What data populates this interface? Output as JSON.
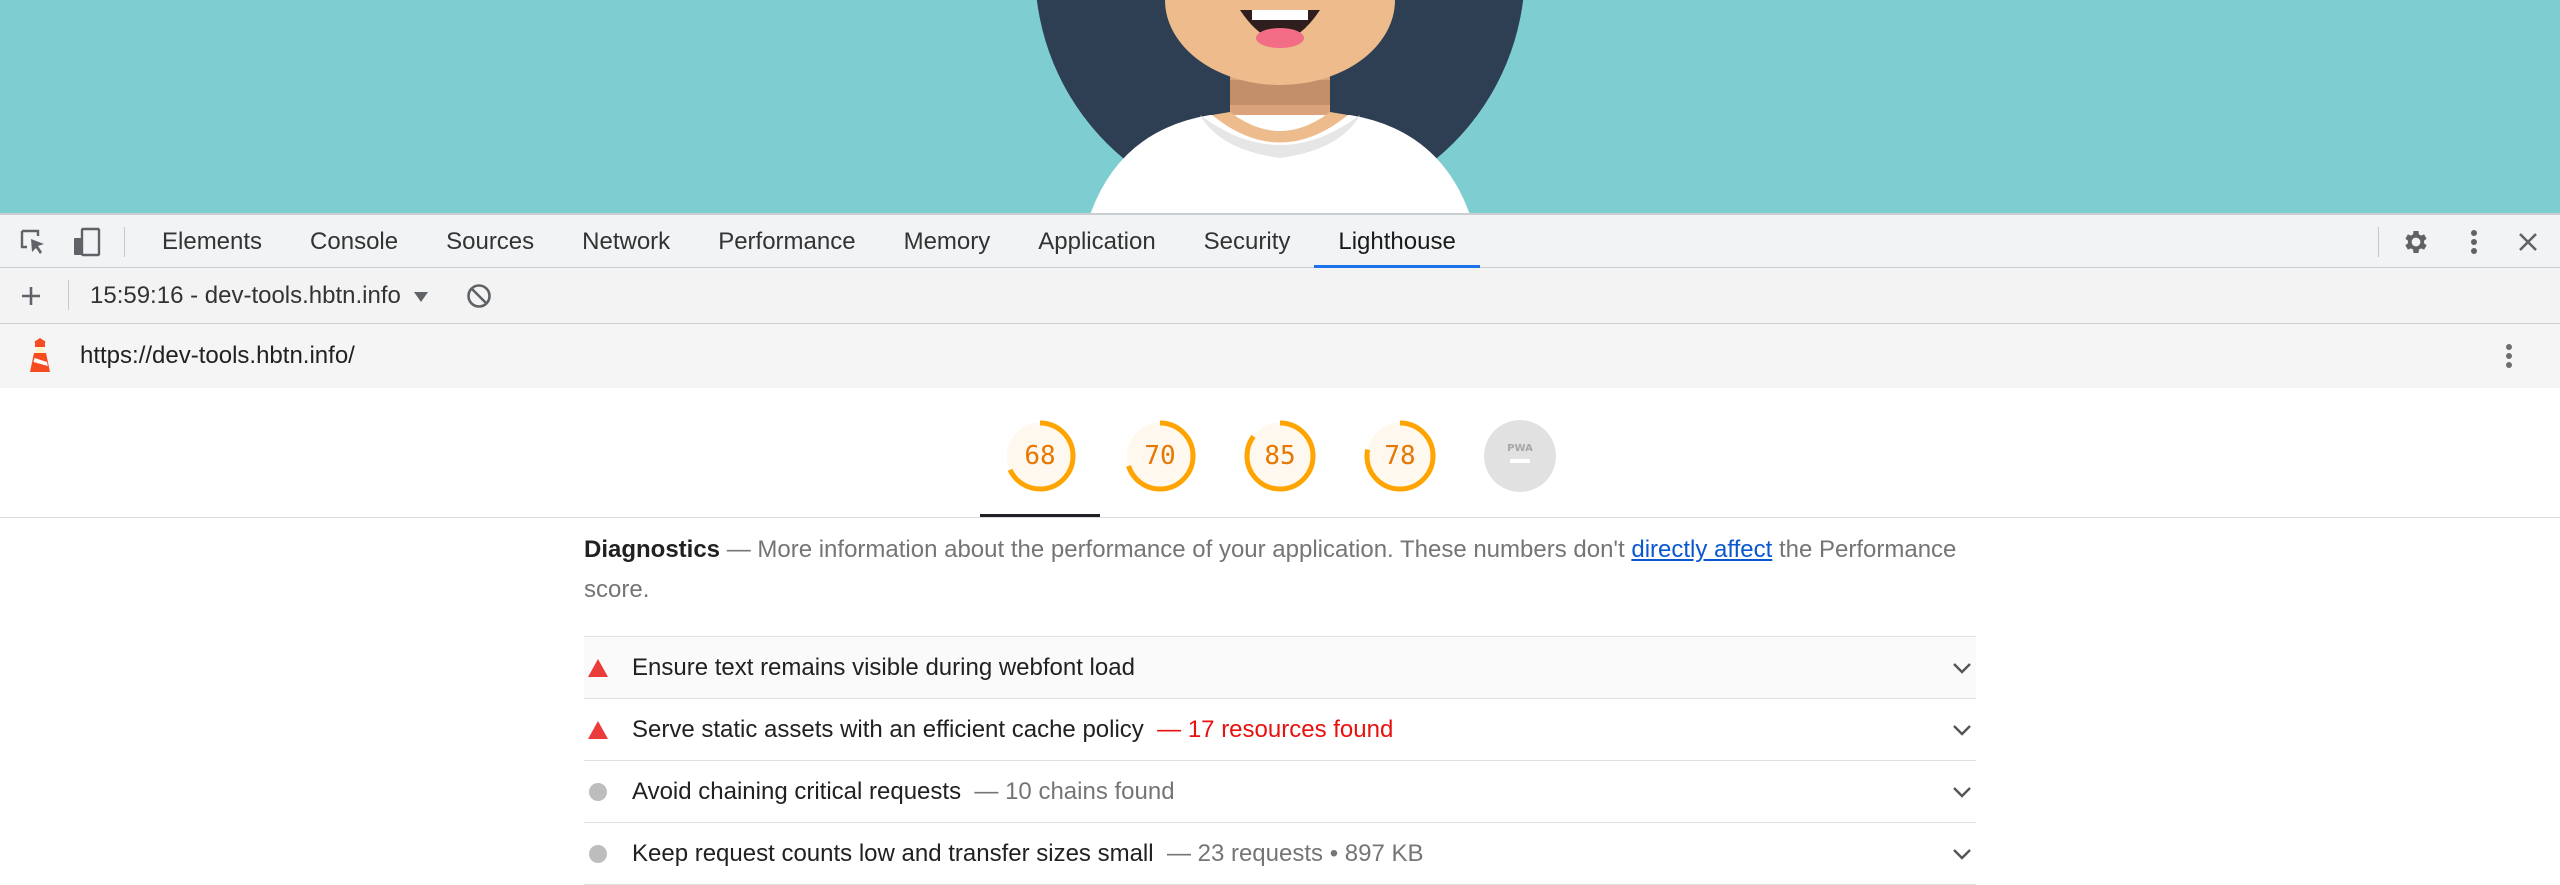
{
  "devtools": {
    "tabs": [
      {
        "label": "Elements"
      },
      {
        "label": "Console"
      },
      {
        "label": "Sources"
      },
      {
        "label": "Network"
      },
      {
        "label": "Performance"
      },
      {
        "label": "Memory"
      },
      {
        "label": "Application"
      },
      {
        "label": "Security"
      },
      {
        "label": "Lighthouse",
        "active": true
      }
    ]
  },
  "report": {
    "selector_label": "15:59:16 - dev-tools.hbtn.info",
    "url": "https://dev-tools.hbtn.info/"
  },
  "gauges": [
    {
      "value": "68",
      "score": 0.68
    },
    {
      "value": "70",
      "score": 0.7
    },
    {
      "value": "85",
      "score": 0.85
    },
    {
      "value": "78",
      "score": 0.78
    },
    {
      "value": "PWA",
      "score": null
    }
  ],
  "diagnostics": {
    "title": "Diagnostics",
    "separator": "—",
    "text_before_link": "More information about the performance of your application. These numbers don't",
    "link_text": "directly affect",
    "text_after_link": "the Performance score."
  },
  "audits": [
    {
      "title": "Ensure text remains visible during webfont load",
      "detail": "",
      "status": "fail"
    },
    {
      "title": "Serve static assets with an efficient cache policy",
      "detail": "— 17 resources found",
      "status": "fail"
    },
    {
      "title": "Avoid chaining critical requests",
      "detail": "— 10 chains found",
      "status": "info"
    },
    {
      "title": "Keep request counts low and transfer sizes small",
      "detail": "— 23 requests • 897 KB",
      "status": "info"
    }
  ],
  "colors": {
    "page_background": "#7ecdd1",
    "gauge_average": "#ffa400",
    "fail": "#eb3c3c",
    "link": "#0b57d0",
    "active_tab_underline": "#1a73e8"
  }
}
